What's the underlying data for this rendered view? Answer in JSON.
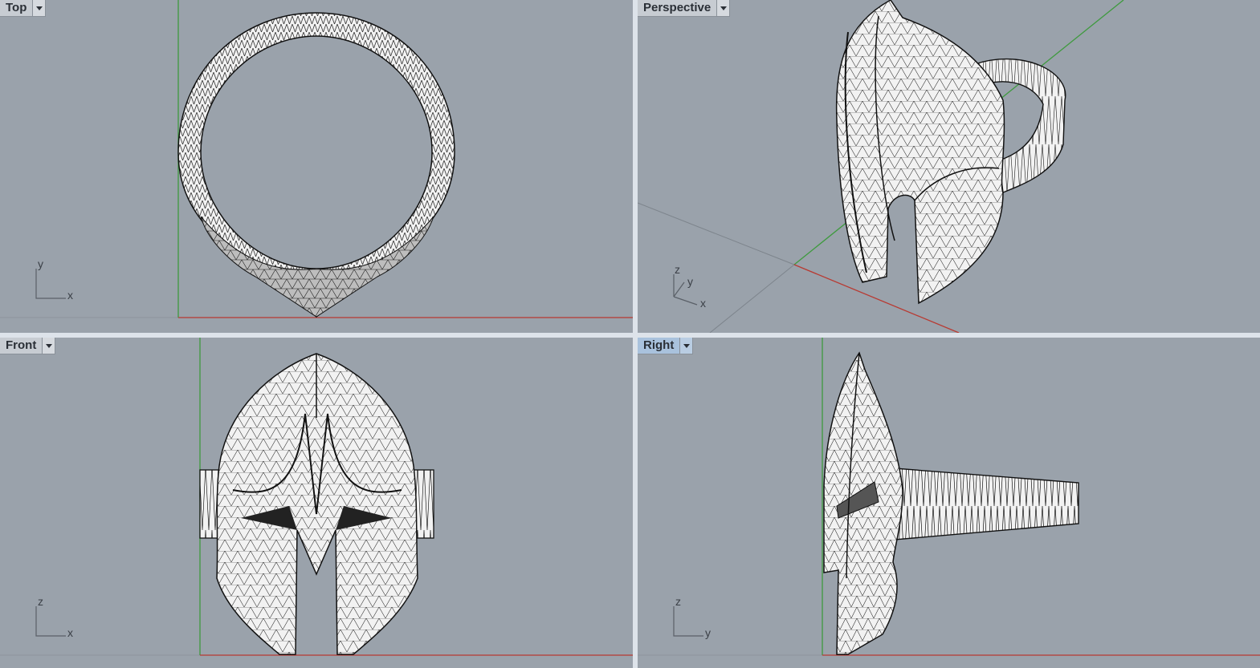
{
  "viewports": {
    "top": {
      "label": "Top",
      "axes": [
        "y",
        "x"
      ]
    },
    "perspective": {
      "label": "Perspective",
      "axes": [
        "z",
        "y",
        "x"
      ]
    },
    "front": {
      "label": "Front",
      "axes": [
        "z",
        "x"
      ]
    },
    "right": {
      "label": "Right",
      "axes": [
        "z",
        "y"
      ],
      "active": true
    }
  },
  "colors": {
    "viewport_bg": "#9aa2ab",
    "x_axis": "#b83a32",
    "y_axis": "#3e9a3e",
    "mesh_fill": "#f2f2f2",
    "mesh_line": "#111111",
    "active_tab": "#a9c2dd"
  },
  "icons": {
    "viewport_menu": "chevron-down-icon"
  }
}
